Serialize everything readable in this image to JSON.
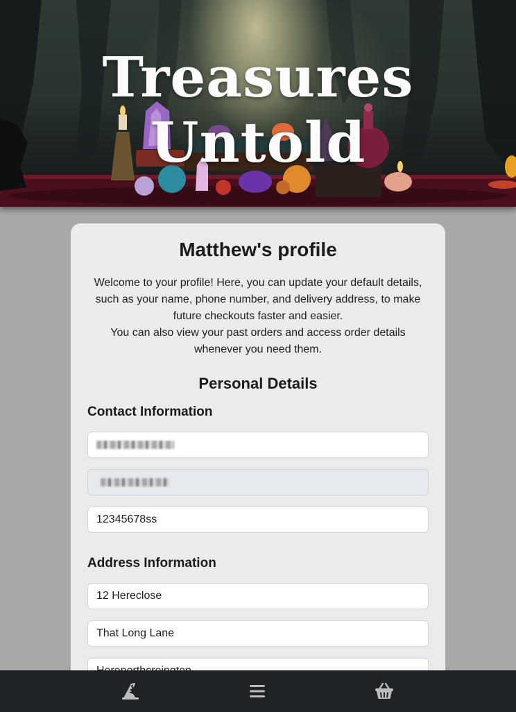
{
  "hero": {
    "title": "Treasures Untold"
  },
  "profile": {
    "title": "Matthew's profile",
    "welcome_line1": "Welcome to your profile! Here, you can update your default details, such as your name, phone number, and delivery address, to make future checkouts faster and easier.",
    "welcome_line2": "You can also view your past orders and access order details whenever you need them."
  },
  "personal_details": {
    "heading": "Personal Details",
    "contact": {
      "heading": "Contact Information",
      "phone_value": "12345678ss"
    },
    "address": {
      "heading": "Address Information",
      "line1": "12 Hereclose",
      "line2": "That Long Lane",
      "line3": "Herenorthcreington"
    }
  },
  "nav": {
    "home_icon": "wizard-hat-icon",
    "menu_icon": "hamburger-menu-icon",
    "basket_icon": "basket-icon"
  },
  "colors": {
    "page_bg": "#a8a8a8",
    "card_bg": "#ebebeb",
    "nav_bg": "#1f2326",
    "readonly_field_bg": "#e6e9ee"
  }
}
